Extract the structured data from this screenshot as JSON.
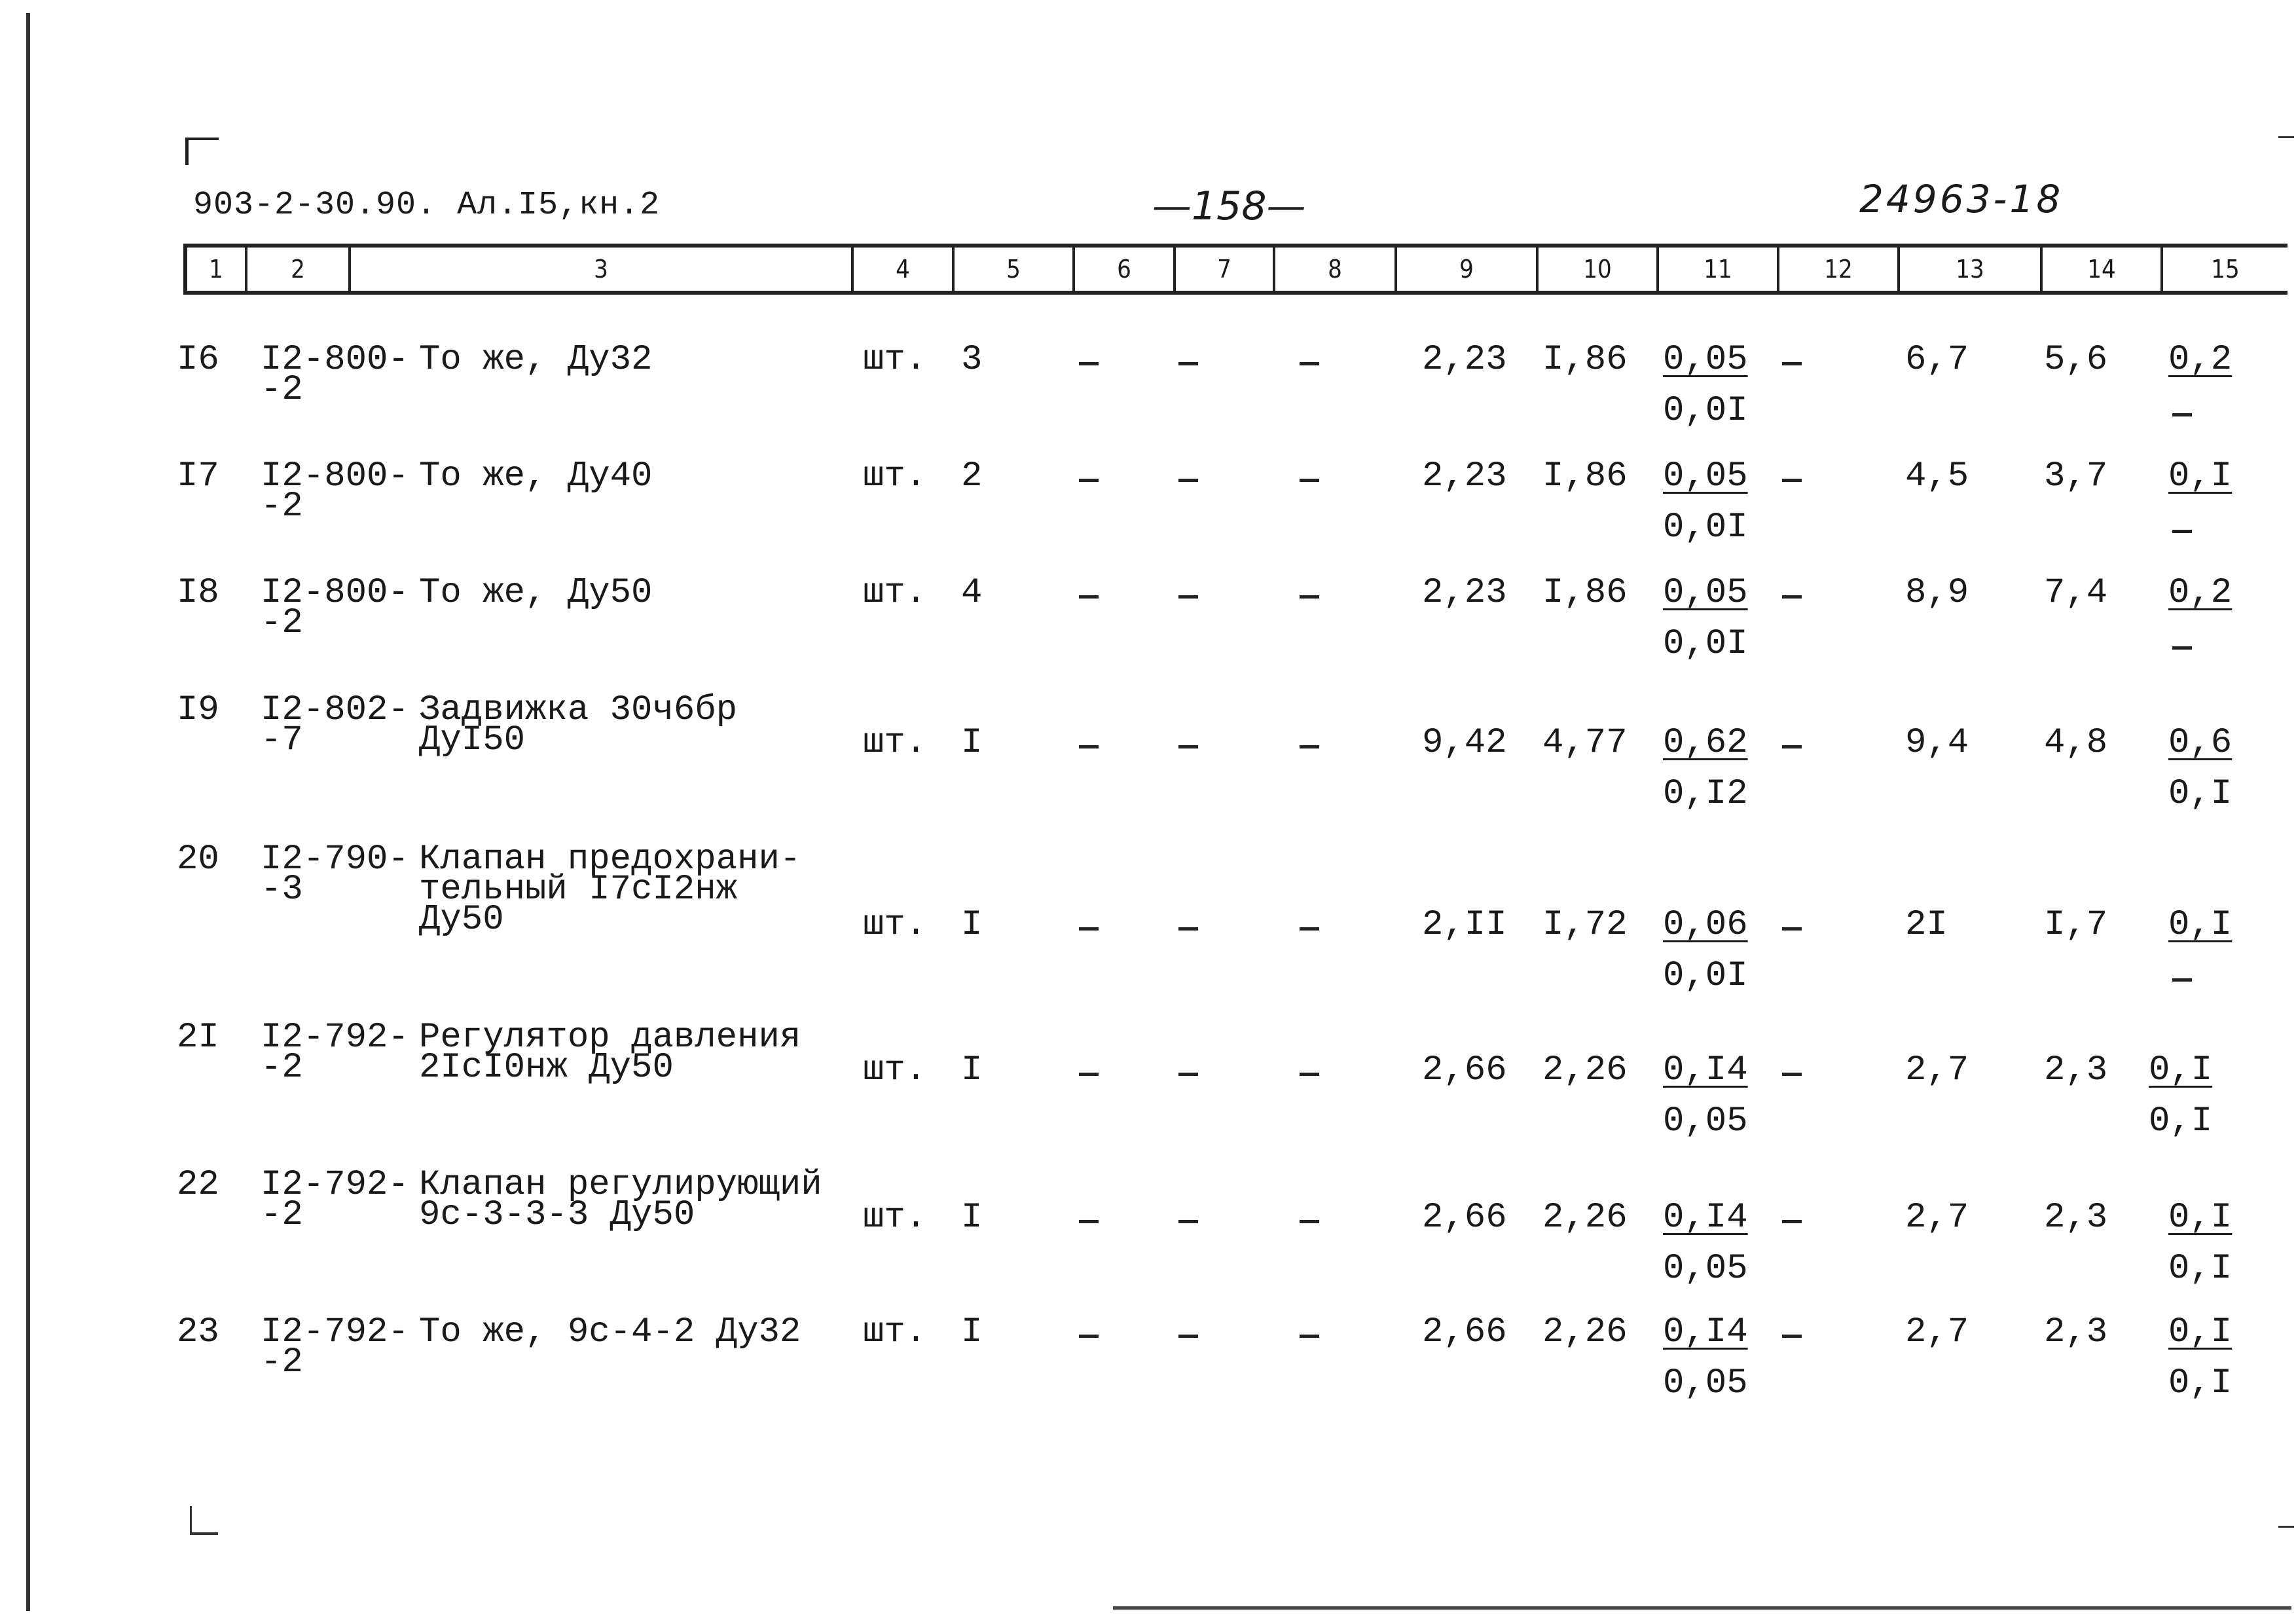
{
  "document": {
    "code": "903-2-30.90. Ал.I5,кн.2",
    "page_number": "—158—",
    "archive_number": "24963-18"
  },
  "columns": [
    "1",
    "2",
    "3",
    "4",
    "5",
    "6",
    "7",
    "8",
    "9",
    "10",
    "11",
    "12",
    "13",
    "14",
    "15"
  ],
  "rows": [
    {
      "n": "I6",
      "code_l1": "I2-800-",
      "code_l2": "-2",
      "name_l1": "То же, Ду32",
      "name_l2": "",
      "name_l3": "",
      "unit": "шт.",
      "qty": "3",
      "c6": "-",
      "c7": "-",
      "c8": "-",
      "c9": "2,23",
      "c10": "I,86",
      "c11_top": "0,05",
      "c11_bot": "0,0I",
      "c12": "-",
      "c13": "6,7",
      "c14": "5,6",
      "c15_top": "0,2",
      "c15_bot": "-"
    },
    {
      "n": "I7",
      "code_l1": "I2-800-",
      "code_l2": "-2",
      "name_l1": "То же, Ду40",
      "name_l2": "",
      "name_l3": "",
      "unit": "шт.",
      "qty": "2",
      "c6": "-",
      "c7": "-",
      "c8": "-",
      "c9": "2,23",
      "c10": "I,86",
      "c11_top": "0,05",
      "c11_bot": "0,0I",
      "c12": "-",
      "c13": "4,5",
      "c14": "3,7",
      "c15_top": "0,I",
      "c15_bot": "-"
    },
    {
      "n": "I8",
      "code_l1": "I2-800-",
      "code_l2": "-2",
      "name_l1": "То же, Ду50",
      "name_l2": "",
      "name_l3": "",
      "unit": "шт.",
      "qty": "4",
      "c6": "-",
      "c7": "-",
      "c8": "-",
      "c9": "2,23",
      "c10": "I,86",
      "c11_top": "0,05",
      "c11_bot": "0,0I",
      "c12": "-",
      "c13": "8,9",
      "c14": "7,4",
      "c15_top": "0,2",
      "c15_bot": "-"
    },
    {
      "n": "I9",
      "code_l1": "I2-802-",
      "code_l2": "-7",
      "name_l1": "Задвижка 30ч6бр",
      "name_l2": "ДуI50",
      "name_l3": "",
      "unit": "шт.",
      "qty": "I",
      "c6": "-",
      "c7": "-",
      "c8": "-",
      "c9": "9,42",
      "c10": "4,77",
      "c11_top": "0,62",
      "c11_bot": "0,I2",
      "c12": "-",
      "c13": "9,4",
      "c14": "4,8",
      "c15_top": "0,6",
      "c15_bot": "0,I"
    },
    {
      "n": "20",
      "code_l1": "I2-790-",
      "code_l2": "-3",
      "name_l1": "Клапан предохрани-",
      "name_l2": "тельный I7cI2нж",
      "name_l3": "Ду50",
      "unit": "шт.",
      "qty": "I",
      "c6": "-",
      "c7": "-",
      "c8": "-",
      "c9": "2,II",
      "c10": "I,72",
      "c11_top": "0,06",
      "c11_bot": "0,0I",
      "c12": "-",
      "c13": "2I",
      "c14": "I,7",
      "c15_top": "0,I",
      "c15_bot": "-"
    },
    {
      "n": "2I",
      "code_l1": "I2-792-",
      "code_l2": "-2",
      "name_l1": "Регулятор давления",
      "name_l2": "2IcI0нж Ду50",
      "name_l3": "",
      "unit": "шт.",
      "qty": "I",
      "c6": "-",
      "c7": "-",
      "c8": "-",
      "c9": "2,66",
      "c10": "2,26",
      "c11_top": "0,I4",
      "c11_bot": "0,05",
      "c12": "-",
      "c13": "2,7",
      "c14": "2,3",
      "c15_top": "0,I",
      "c15_bot": "0,I"
    },
    {
      "n": "22",
      "code_l1": "I2-792-",
      "code_l2": "-2",
      "name_l1": "Клапан регулирующий",
      "name_l2": "9с-3-3-3 Ду50",
      "name_l3": "",
      "unit": "шт.",
      "qty": "I",
      "c6": "-",
      "c7": "-",
      "c8": "-",
      "c9": "2,66",
      "c10": "2,26",
      "c11_top": "0,I4",
      "c11_bot": "0,05",
      "c12": "-",
      "c13": "2,7",
      "c14": "2,3",
      "c15_top": "0,I",
      "c15_bot": "0,I"
    },
    {
      "n": "23",
      "code_l1": "I2-792-",
      "code_l2": "-2",
      "name_l1": "То же, 9с-4-2 Ду32",
      "name_l2": "",
      "name_l3": "",
      "unit": "шт.",
      "qty": "I",
      "c6": "-",
      "c7": "-",
      "c8": "-",
      "c9": "2,66",
      "c10": "2,26",
      "c11_top": "0,I4",
      "c11_bot": "0,05",
      "c12": "-",
      "c13": "2,7",
      "c14": "2,3",
      "c15_top": "0,I",
      "c15_bot": "0,I"
    }
  ]
}
